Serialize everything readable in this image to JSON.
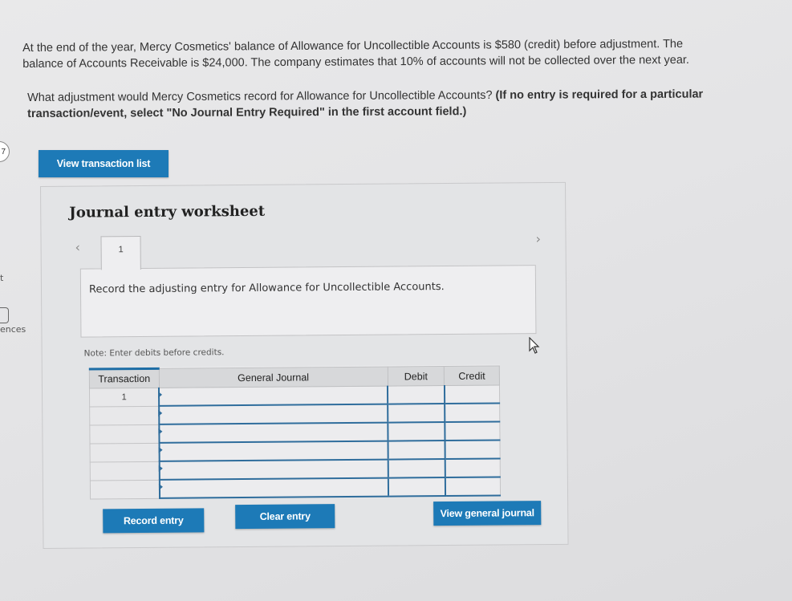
{
  "question": {
    "line1": "At the end of the year, Mercy Cosmetics' balance of Allowance for Uncollectible Accounts is $580 (credit) before adjustment. The",
    "line2": "balance of Accounts Receivable is $24,000. The company estimates that 10% of accounts will not be collected over the next year.",
    "prompt": "What adjustment would Mercy Cosmetics record for Allowance for Uncollectible Accounts?",
    "instruction": "(If no entry is required for a particular transaction/event, select \"No Journal Entry Required\" in the first account field.)"
  },
  "side": {
    "badge": "7",
    "frag_t": "t",
    "frag_ences": "ences"
  },
  "buttons": {
    "view_transaction_list": "View transaction list",
    "record_entry": "Record entry",
    "clear_entry": "Clear entry",
    "view_general_journal": "View general journal"
  },
  "worksheet": {
    "title": "Journal entry worksheet",
    "tab_number": "1",
    "instruction": "Record the adjusting entry for Allowance for Uncollectible Accounts.",
    "note": "Note: Enter debits before credits."
  },
  "journal": {
    "headers": [
      "Transaction",
      "General Journal",
      "Debit",
      "Credit"
    ],
    "rows": [
      {
        "transaction": "1",
        "account": "",
        "debit": "",
        "credit": ""
      },
      {
        "transaction": "",
        "account": "",
        "debit": "",
        "credit": ""
      },
      {
        "transaction": "",
        "account": "",
        "debit": "",
        "credit": ""
      },
      {
        "transaction": "",
        "account": "",
        "debit": "",
        "credit": ""
      },
      {
        "transaction": "",
        "account": "",
        "debit": "",
        "credit": ""
      },
      {
        "transaction": "",
        "account": "",
        "debit": "",
        "credit": ""
      }
    ]
  },
  "colors": {
    "accent": "#1d7ab7",
    "rule": "#2f6d9c"
  }
}
